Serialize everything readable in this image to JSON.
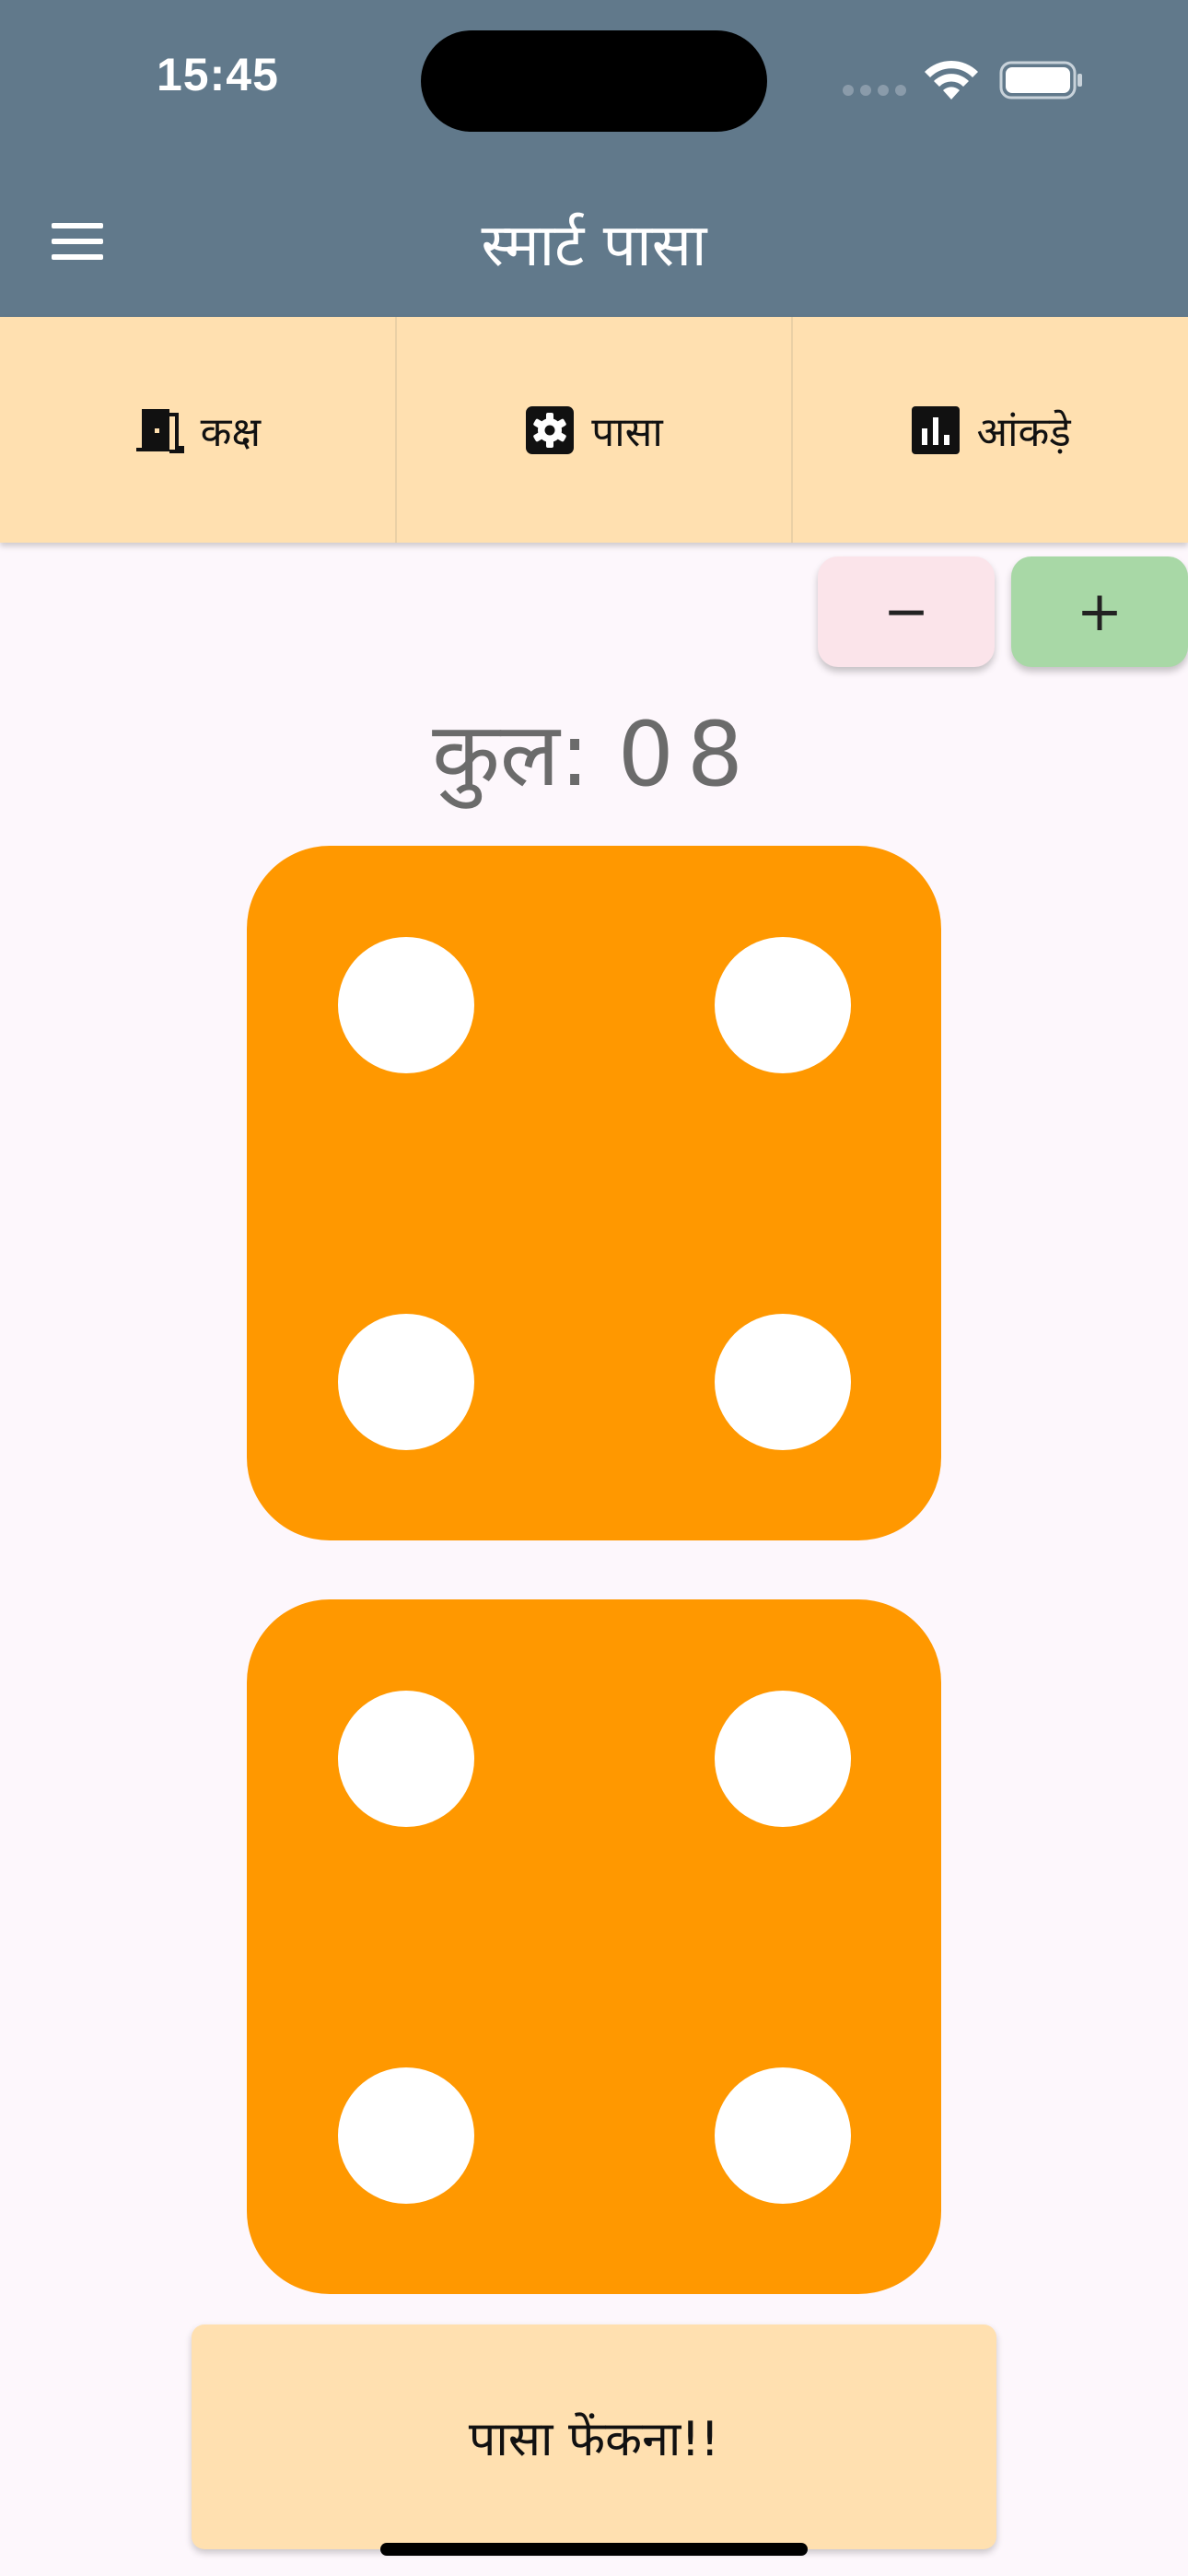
{
  "status_bar": {
    "time": "15:45"
  },
  "app_bar": {
    "title": "स्मार्ट पासा",
    "menu_icon": "hamburger-menu-icon"
  },
  "tabs": [
    {
      "label": "कक्ष",
      "icon": "door-icon"
    },
    {
      "label": "पासा",
      "icon": "settings-gear-icon"
    },
    {
      "label": "आंकड़े",
      "icon": "bar-chart-icon"
    }
  ],
  "stepper": {
    "minus_label": "−",
    "plus_label": "+"
  },
  "total": {
    "label": "कुल:",
    "value": "08"
  },
  "dice": [
    {
      "value": 4
    },
    {
      "value": 4
    }
  ],
  "roll_button": {
    "label": "पासा फेंकना!!"
  },
  "colors": {
    "app_bar": "#61798b",
    "tabs_bg": "#ffe0b0",
    "die": "#ff9800",
    "pip": "#ffffff",
    "minus_bg": "#fbe4ea",
    "plus_bg": "#a8d8a6",
    "page_bg": "#fdf7fc"
  }
}
